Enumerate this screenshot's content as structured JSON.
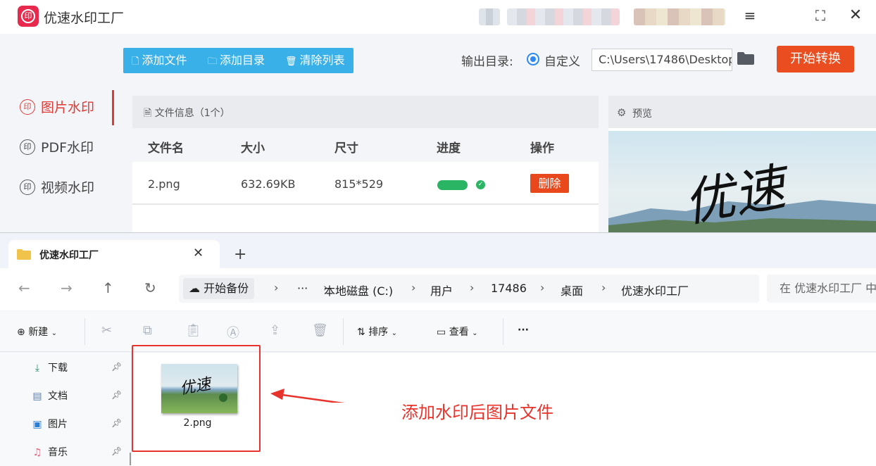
{
  "app": {
    "title": "优速水印工厂",
    "logo_glyph": "印",
    "window_controls": {
      "menu": "≡",
      "maximize": "⛶",
      "close": "✕"
    },
    "sidebar": [
      {
        "label": "图片水印",
        "active": true
      },
      {
        "label": "PDF水印",
        "active": false
      },
      {
        "label": "视频水印",
        "active": false
      }
    ],
    "toolbar": {
      "add_file": "添加文件",
      "add_dir": "添加目录",
      "clear_list": "清除列表"
    },
    "output": {
      "label": "输出目录:",
      "option": "自定义",
      "path": "C:\\Users\\17486\\Desktop",
      "start_button": "开始转换"
    },
    "file_panel": {
      "title": "文件信息（1个）",
      "columns": [
        "文件名",
        "大小",
        "尺寸",
        "进度",
        "操作"
      ],
      "rows": [
        {
          "name": "2.png",
          "size": "632.69KB",
          "dimensions": "815*529",
          "progress": 1.0,
          "action": "删除"
        }
      ]
    },
    "preview": {
      "title": "预览",
      "watermark_text": "优速"
    }
  },
  "explorer": {
    "tab_title": "优速水印工厂",
    "tab_close": "✕",
    "new_tab": "+",
    "address": {
      "backup": "开始备份",
      "ellipsis": "···",
      "crumbs": [
        "本地磁盘 (C:)",
        "用户",
        "17486",
        "桌面",
        "优速水印工厂"
      ]
    },
    "search_placeholder": "在 优速水印工厂 中",
    "commands": {
      "new": "新建",
      "sort": "排序",
      "view": "查看",
      "more": "···"
    },
    "nav_items": [
      {
        "label": "下载",
        "icon": "download-icon"
      },
      {
        "label": "文档",
        "icon": "document-icon"
      },
      {
        "label": "图片",
        "icon": "pictures-icon"
      },
      {
        "label": "音乐",
        "icon": "music-icon"
      }
    ],
    "file": {
      "name": "2.png",
      "thumb_watermark": "优速"
    }
  },
  "annotation": "添加水印后图片文件",
  "colors": {
    "accent_red": "#e8332c",
    "toolbar_blue": "#3ab0e9",
    "start_orange": "#ea4d1f",
    "progress_green": "#2ab564"
  }
}
